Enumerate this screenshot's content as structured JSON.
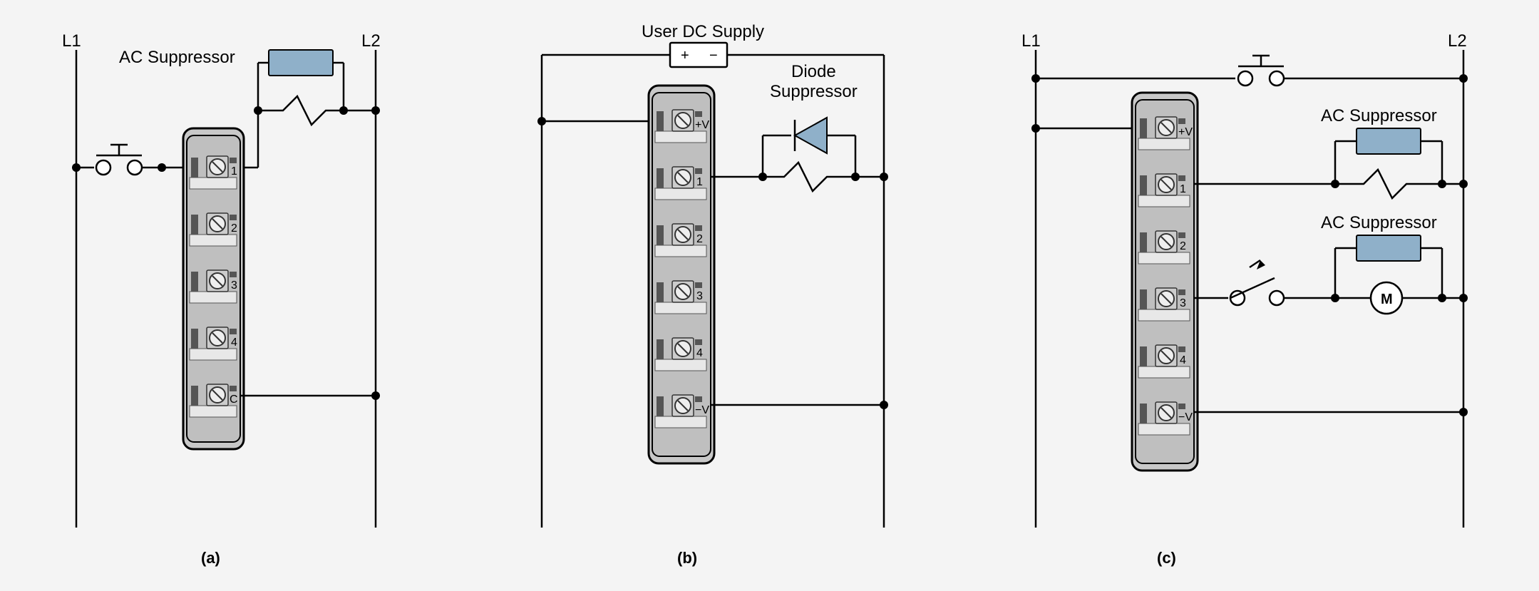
{
  "panels": {
    "a": {
      "L1": "L1",
      "L2": "L2",
      "suppressor": "AC Suppressor",
      "caption": "(a)",
      "terminals": [
        "1",
        "2",
        "3",
        "4",
        "C"
      ]
    },
    "b": {
      "title": "User DC Supply",
      "plus": "+",
      "minus": "−",
      "suppressor": "Diode\nSuppressor",
      "suppressor_l1": "Diode",
      "suppressor_l2": "Suppressor",
      "caption": "(b)",
      "terminals": [
        "+V",
        "1",
        "2",
        "3",
        "4",
        "−V"
      ]
    },
    "c": {
      "L1": "L1",
      "L2": "L2",
      "suppressor1": "AC Suppressor",
      "suppressor2": "AC Suppressor",
      "motor": "M",
      "caption": "(c)",
      "terminals": [
        "+V",
        "1",
        "2",
        "3",
        "4",
        "−V"
      ]
    }
  }
}
